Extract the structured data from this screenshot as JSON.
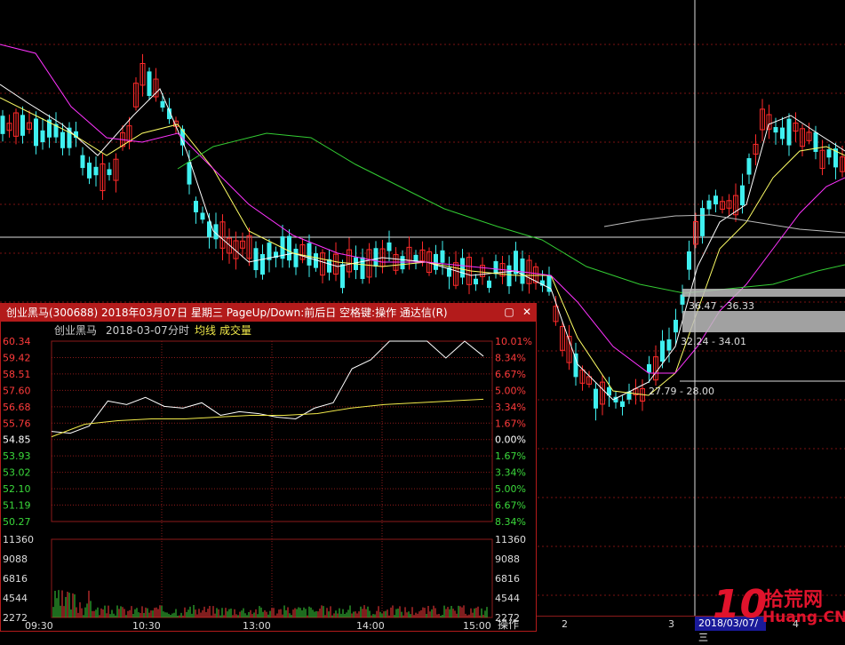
{
  "popup": {
    "title": "创业黑马(300688) 2018年03月07日 星期三 PageUp/Down:前后日 空格键:操作 通达信(R)",
    "restore_icon": "restore-icon",
    "close_icon": "close-icon",
    "stock_name": "创业黑马",
    "date": "2018-03-07",
    "mode": "分时",
    "avg_label": "均线",
    "vol_label": "成交量",
    "price_ticks": [
      "60.34",
      "59.42",
      "58.51",
      "57.60",
      "56.68",
      "55.76",
      "54.85",
      "53.93",
      "53.02",
      "52.10",
      "51.19",
      "50.27"
    ],
    "pct_ticks": [
      "10.01%",
      "8.34%",
      "6.67%",
      "5.00%",
      "3.34%",
      "1.67%",
      "0.00%",
      "1.67%",
      "3.34%",
      "5.00%",
      "6.67%",
      "8.34%"
    ],
    "vol_ticks": [
      "11360",
      "9088",
      "6816",
      "4544",
      "2272"
    ],
    "time_ticks": [
      "09:30",
      "10:30",
      "13:00",
      "14:00",
      "15:00"
    ],
    "colors": {
      "up": "#ff3b3b",
      "down": "#3bd93b",
      "flat": "#ffffff",
      "price_line": "#ffffff",
      "avg_line": "#f2ea4a",
      "grid": "#8b1a1a"
    }
  },
  "kline": {
    "price_labels": [
      "36.47 - 36.33",
      "32.24 - 34.01",
      "27.79 - 28.00"
    ],
    "colors": {
      "up": "#ff2a2a",
      "down": "#3ff0f0",
      "ma5": "#ffffff",
      "ma10": "#ffff66",
      "ma20": "#ff33ff",
      "ma60": "#33cc33",
      "ma120": "#bbbbbb"
    }
  },
  "bottom_bar": {
    "op_label": "操作",
    "seg2": "2",
    "seg3": "3",
    "date_text": "2018/03/07/三",
    "seg4": "4"
  },
  "watermark": {
    "big": "10",
    "top": "拾荒网",
    "bottom": "Huang.CN"
  },
  "chart_data": {
    "type": "line",
    "title": "",
    "x": [
      "09:30",
      "10:30",
      "13:00",
      "14:00",
      "15:00"
    ],
    "ylim": [
      50.27,
      60.34
    ],
    "prev_close": 54.85,
    "series": [
      {
        "values": [
          55.3,
          55.2,
          55.6,
          57.0,
          56.8,
          57.2,
          56.7,
          56.6,
          56.9,
          56.2,
          56.4,
          56.3,
          56.1,
          56.0,
          56.6,
          56.9,
          58.8,
          59.3,
          60.34,
          60.34,
          60.34,
          59.4,
          60.34,
          59.5
        ]
      },
      {
        "values": [
          55.0,
          55.7,
          55.9,
          56.0,
          56.0,
          56.1,
          56.2,
          56.2,
          56.3,
          56.6,
          56.8,
          56.9,
          57.0,
          57.1
        ]
      }
    ]
  }
}
